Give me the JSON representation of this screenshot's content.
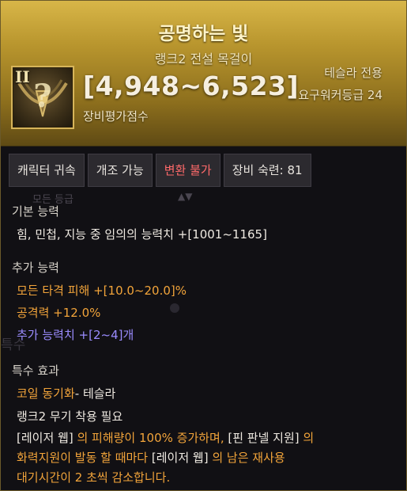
{
  "item": {
    "name": "공명하는 빛",
    "subtitle": "랭크2 전설 목걸이",
    "tier": "II",
    "score": "[4,948~6,523]",
    "score_label": "장비평가점수",
    "class_req": "테슬라 전용",
    "level_req": "요구워커등급 24"
  },
  "badges": [
    {
      "label": "캐릭터 귀속"
    },
    {
      "label": "개조 가능"
    },
    {
      "label": "변환 불가"
    },
    {
      "label": "장비 숙련: 81"
    }
  ],
  "ghost": {
    "label": "모든 등급",
    "arrow": "▲▼",
    "side": "특수"
  },
  "base": {
    "title": "기본 능력",
    "line": "힘, 민첩, 지능 중 임의의 능력치 +[1001~1165]"
  },
  "additional": {
    "title": "추가 능력",
    "lines": [
      "모든 타격 피해  +[10.0~20.0]%",
      "공격력  +12.0%",
      "추가 능력치 +[2~4]개"
    ]
  },
  "special": {
    "title": "특수 효과",
    "effect_name": "코일 동기화",
    "effect_suffix": "- 테슬라",
    "requirement": "랭크2 무기 착용 필요",
    "desc": {
      "p1": "[레이저 웹]",
      "p2": " 의 피해량이 100% 증가하며, ",
      "p3": "[핀 판넬 지원]",
      "p4": " 의 ",
      "p5": "화력지원",
      "p6": "이 발동 할 때마다 ",
      "p7": "[레이저 웹]",
      "p8": " 의 남은 재사용",
      "p9": "대기시간이 2 초씩 감소합니다."
    }
  },
  "colors": {
    "header_gold": "#c9a53a",
    "orange_text": "#f2a43a",
    "purple_text": "#9b8cff",
    "red_badge": "#ff6a6a"
  }
}
